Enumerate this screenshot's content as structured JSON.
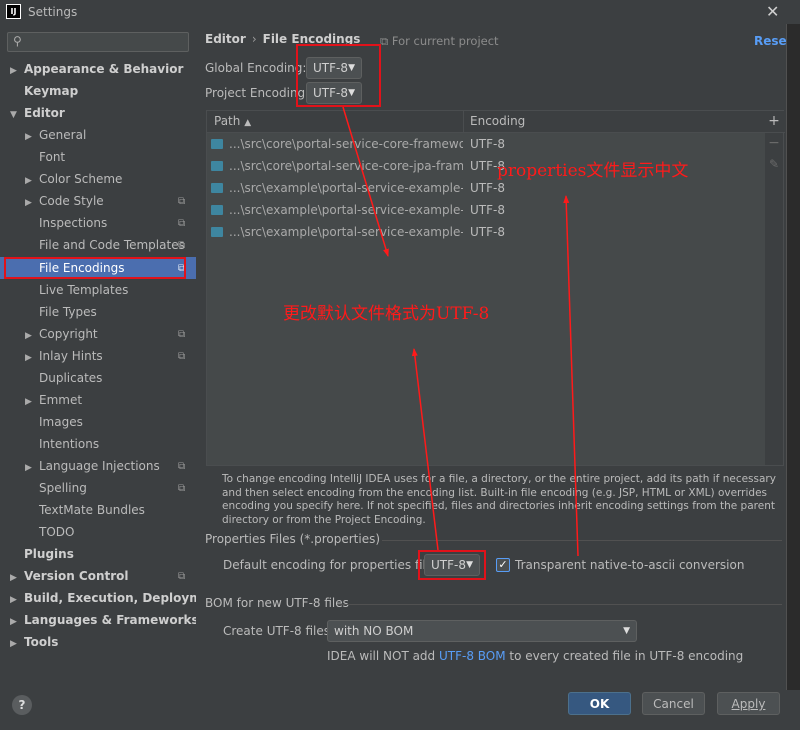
{
  "window": {
    "title": "Settings",
    "app_icon": "IJ"
  },
  "sidebar": {
    "search_placeholder": "",
    "items": [
      {
        "label": "Appearance & Behavior",
        "arrow": "▶"
      },
      {
        "label": "Keymap"
      },
      {
        "label": "Editor",
        "arrow": "▼"
      },
      {
        "label": "General",
        "arrow": "▶"
      },
      {
        "label": "Font"
      },
      {
        "label": "Color Scheme",
        "arrow": "▶"
      },
      {
        "label": "Code Style",
        "arrow": "▶"
      },
      {
        "label": "Inspections"
      },
      {
        "label": "File and Code Templates"
      },
      {
        "label": "File Encodings"
      },
      {
        "label": "Live Templates"
      },
      {
        "label": "File Types"
      },
      {
        "label": "Copyright",
        "arrow": "▶"
      },
      {
        "label": "Inlay Hints",
        "arrow": "▶"
      },
      {
        "label": "Duplicates"
      },
      {
        "label": "Emmet",
        "arrow": "▶"
      },
      {
        "label": "Images"
      },
      {
        "label": "Intentions"
      },
      {
        "label": "Language Injections",
        "arrow": "▶"
      },
      {
        "label": "Spelling"
      },
      {
        "label": "TextMate Bundles"
      },
      {
        "label": "TODO"
      },
      {
        "label": "Plugins"
      },
      {
        "label": "Version Control",
        "arrow": "▶"
      },
      {
        "label": "Build, Execution, Deployment",
        "arrow": "▶"
      },
      {
        "label": "Languages & Frameworks",
        "arrow": "▶"
      },
      {
        "label": "Tools",
        "arrow": "▶"
      }
    ]
  },
  "header": {
    "breadcrumb_parent": "Editor",
    "breadcrumb_sep": "›",
    "breadcrumb_current": "File Encodings",
    "for_project": "For current project",
    "reset": "Reset"
  },
  "encodings": {
    "global_label": "Global Encoding:",
    "global_value": "UTF-8",
    "project_label": "Project Encoding:",
    "project_value": "UTF-8"
  },
  "table": {
    "col_path": "Path",
    "col_encoding": "Encoding",
    "sort_arrow": "▲",
    "rows": [
      {
        "path": "...\\src\\core\\portal-service-core-framework\\src",
        "encoding": "UTF-8"
      },
      {
        "path": "...\\src\\core\\portal-service-core-jpa-framework",
        "encoding": "UTF-8"
      },
      {
        "path": "...\\src\\example\\portal-service-example-core\\sr",
        "encoding": "UTF-8"
      },
      {
        "path": "...\\src\\example\\portal-service-example-multipl",
        "encoding": "UTF-8"
      },
      {
        "path": "...\\src\\example\\portal-service-example-no-dat",
        "encoding": "UTF-8"
      }
    ],
    "tools": {
      "add": "+",
      "remove": "−",
      "edit": "✎"
    }
  },
  "info_text": "To change encoding IntelliJ IDEA uses for a file, a directory, or the entire project, add its path if necessary and then select encoding from the encoding list. Built-in file encoding (e.g. JSP, HTML or XML) overrides encoding you specify here. If not specified, files and directories inherit encoding settings from the parent directory or from the Project Encoding.",
  "properties": {
    "section_title": "Properties Files (*.properties)",
    "default_label": "Default encoding for properties files:",
    "default_value": "UTF-8",
    "native_checkbox_label": "Transparent native-to-ascii conversion",
    "native_checked": true
  },
  "bom": {
    "section_title": "BOM for new UTF-8 files",
    "create_label": "Create UTF-8 files:",
    "create_value": "with NO BOM",
    "note_prefix": "IDEA will NOT add ",
    "note_link": "UTF-8 BOM",
    "note_suffix": " to every created file in UTF-8 encoding"
  },
  "buttons": {
    "help": "?",
    "ok": "OK",
    "cancel": "Cancel",
    "apply": "Apply"
  },
  "annotations": {
    "properties_note": "properties文件显示中文",
    "default_note": "更改默认文件格式为UTF-8",
    "color": "#ff1a1a"
  }
}
